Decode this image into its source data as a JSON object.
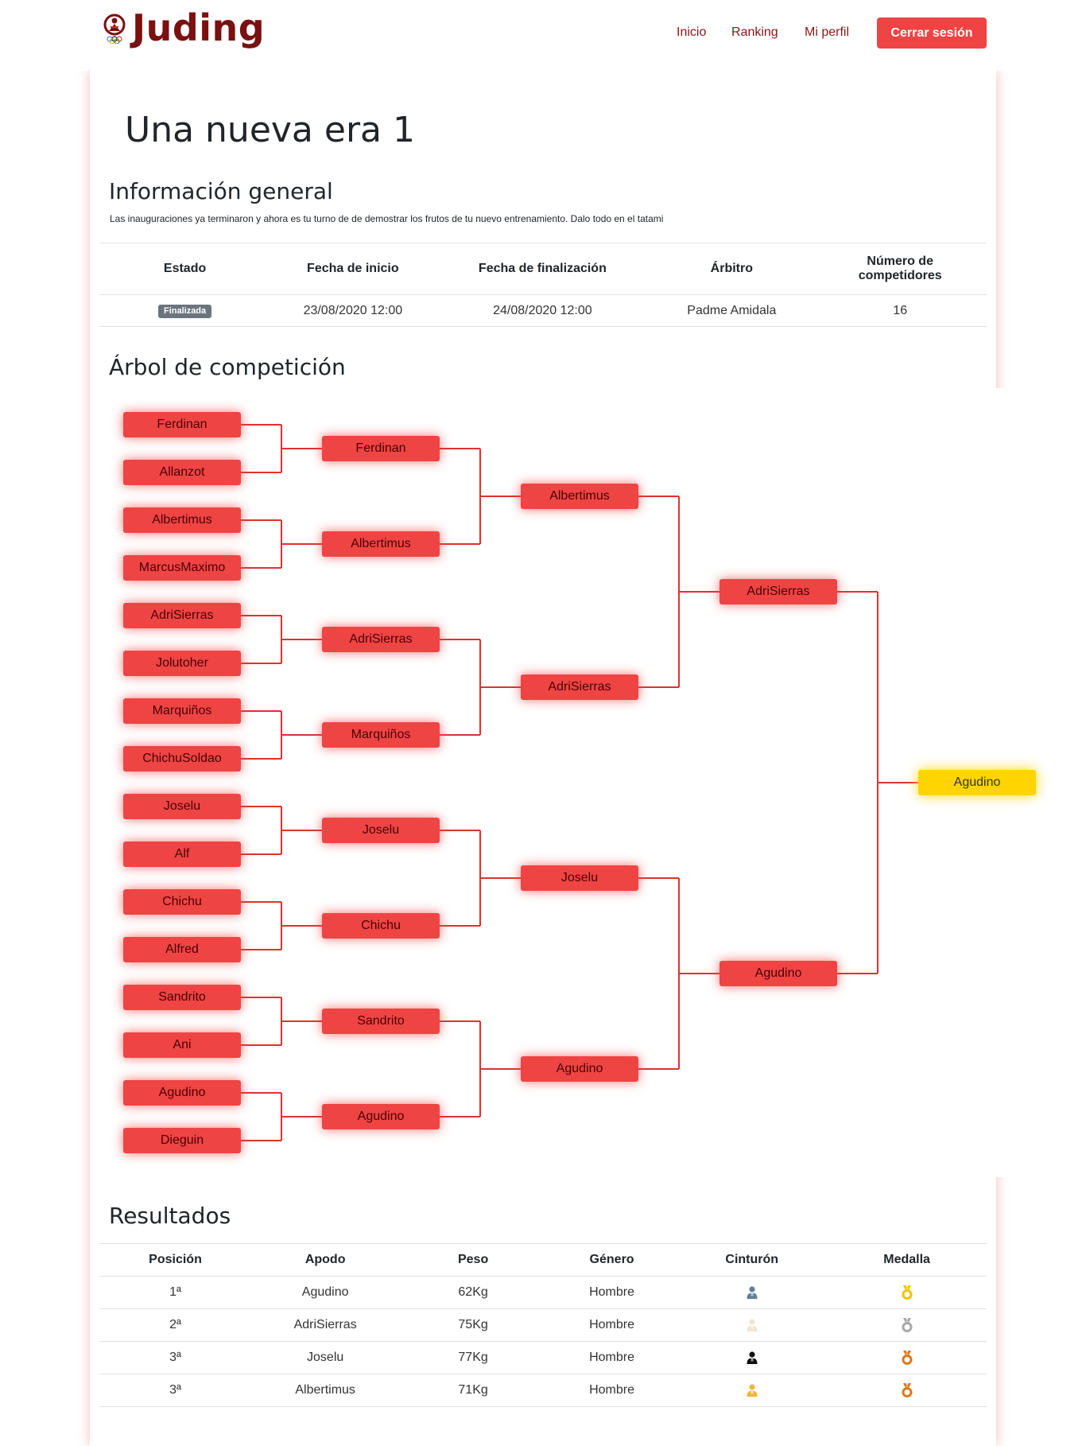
{
  "navbar": {
    "brand": "Juding",
    "links": [
      "Inicio",
      "Ranking",
      "Mi perfil"
    ],
    "logout": "Cerrar sesión"
  },
  "page": {
    "title": "Una nueva era 1",
    "info_heading": "Información general",
    "description": "Las inauguraciones ya terminaron y ahora es tu turno de de demostrar los frutos de tu nuevo entrenamiento. Dalo todo en el tatami",
    "bracket_heading": "Árbol de competición",
    "results_heading": "Resultados"
  },
  "info_table": {
    "headers": [
      "Estado",
      "Fecha de inicio",
      "Fecha de finalización",
      "Árbitro",
      "Número de competidores"
    ],
    "status": "Finalizada",
    "start": "23/08/2020 12:00",
    "end": "24/08/2020 12:00",
    "referee": "Padme Amidala",
    "competitors": "16"
  },
  "bracket": {
    "round1": [
      "Ferdinan",
      "Allanzot",
      "Albertimus",
      "MarcusMaximo",
      "AdriSierras",
      "Jolutoher",
      "Marquiños",
      "ChichuSoldao",
      "Joselu",
      "Alf",
      "Chichu",
      "Alfred",
      "Sandrito",
      "Ani",
      "Agudino",
      "Dieguin"
    ],
    "round2": [
      "Ferdinan",
      "Albertimus",
      "AdriSierras",
      "Marquiños",
      "Joselu",
      "Chichu",
      "Sandrito",
      "Agudino"
    ],
    "round3": [
      "Albertimus",
      "AdriSierras",
      "Joselu",
      "Agudino"
    ],
    "round4": [
      "AdriSierras",
      "Agudino"
    ],
    "champion": "Agudino"
  },
  "results": {
    "headers": [
      "Posición",
      "Apodo",
      "Peso",
      "Género",
      "Cinturón",
      "Medalla"
    ],
    "rows": [
      {
        "pos": "1ª",
        "nick": "Agudino",
        "weight": "62Kg",
        "gender": "Hombre",
        "belt": "blue",
        "belt_color": "#5f7f96",
        "medal": "gold",
        "medal_color": "#f2c200"
      },
      {
        "pos": "2ª",
        "nick": "AdriSierras",
        "weight": "75Kg",
        "gender": "Hombre",
        "belt": "white",
        "belt_color": "#f0e6d4",
        "medal": "silver",
        "medal_color": "#a8a8a8"
      },
      {
        "pos": "3ª",
        "nick": "Joselu",
        "weight": "77Kg",
        "gender": "Hombre",
        "belt": "black",
        "belt_color": "#111111",
        "medal": "bronze",
        "medal_color": "#d97a1c"
      },
      {
        "pos": "3ª",
        "nick": "Albertimus",
        "weight": "71Kg",
        "gender": "Hombre",
        "belt": "yellow",
        "belt_color": "#f4b43a",
        "medal": "bronze",
        "medal_color": "#d97a1c"
      }
    ]
  },
  "colors": {
    "brand": "#7a1010",
    "accent": "#ef4444",
    "champion": "#ffd400"
  }
}
